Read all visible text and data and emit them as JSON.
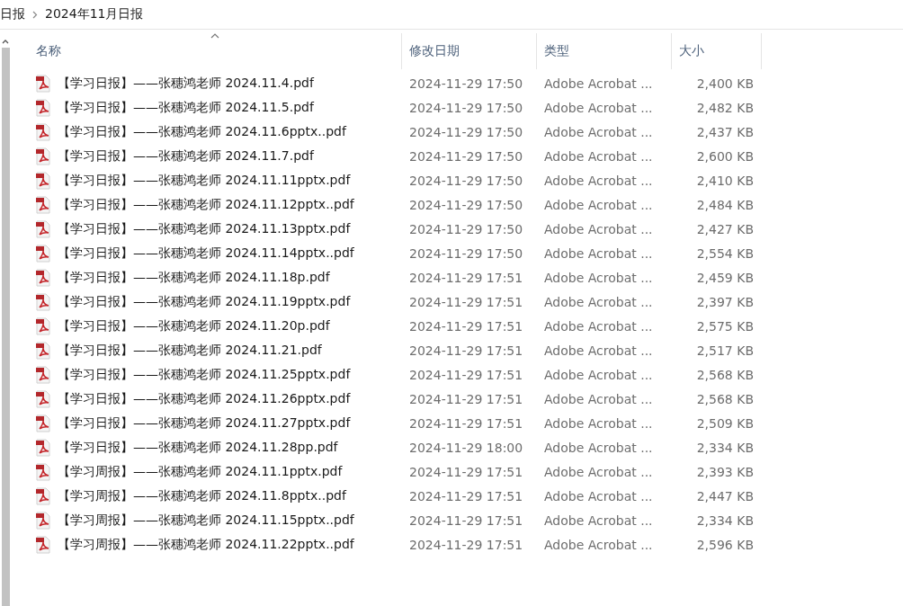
{
  "breadcrumb": [
    "日报",
    "2024年11月日报"
  ],
  "table": {
    "columns": [
      {
        "label": "名称",
        "sorted": true
      },
      {
        "label": "修改日期",
        "sorted": false
      },
      {
        "label": "类型",
        "sorted": false
      },
      {
        "label": "大小",
        "sorted": false
      }
    ],
    "rows": [
      {
        "name": "【学习日报】——张穗鸿老师 2024.11.4.pdf",
        "modified": "2024-11-29 17:50",
        "type": "Adobe Acrobat ...",
        "size": "2,400 KB"
      },
      {
        "name": "【学习日报】——张穗鸿老师 2024.11.5.pdf",
        "modified": "2024-11-29 17:50",
        "type": "Adobe Acrobat ...",
        "size": "2,482 KB"
      },
      {
        "name": "【学习日报】——张穗鸿老师 2024.11.6pptx..pdf",
        "modified": "2024-11-29 17:50",
        "type": "Adobe Acrobat ...",
        "size": "2,437 KB"
      },
      {
        "name": "【学习日报】——张穗鸿老师 2024.11.7.pdf",
        "modified": "2024-11-29 17:50",
        "type": "Adobe Acrobat ...",
        "size": "2,600 KB"
      },
      {
        "name": "【学习日报】——张穗鸿老师 2024.11.11pptx.pdf",
        "modified": "2024-11-29 17:50",
        "type": "Adobe Acrobat ...",
        "size": "2,410 KB"
      },
      {
        "name": "【学习日报】——张穗鸿老师 2024.11.12pptx..pdf",
        "modified": "2024-11-29 17:50",
        "type": "Adobe Acrobat ...",
        "size": "2,484 KB"
      },
      {
        "name": "【学习日报】——张穗鸿老师 2024.11.13pptx.pdf",
        "modified": "2024-11-29 17:50",
        "type": "Adobe Acrobat ...",
        "size": "2,427 KB"
      },
      {
        "name": "【学习日报】——张穗鸿老师 2024.11.14pptx..pdf",
        "modified": "2024-11-29 17:50",
        "type": "Adobe Acrobat ...",
        "size": "2,554 KB"
      },
      {
        "name": "【学习日报】——张穗鸿老师 2024.11.18p.pdf",
        "modified": "2024-11-29 17:51",
        "type": "Adobe Acrobat ...",
        "size": "2,459 KB"
      },
      {
        "name": "【学习日报】——张穗鸿老师 2024.11.19pptx.pdf",
        "modified": "2024-11-29 17:51",
        "type": "Adobe Acrobat ...",
        "size": "2,397 KB"
      },
      {
        "name": "【学习日报】——张穗鸿老师 2024.11.20p.pdf",
        "modified": "2024-11-29 17:51",
        "type": "Adobe Acrobat ...",
        "size": "2,575 KB"
      },
      {
        "name": "【学习日报】——张穗鸿老师 2024.11.21.pdf",
        "modified": "2024-11-29 17:51",
        "type": "Adobe Acrobat ...",
        "size": "2,517 KB"
      },
      {
        "name": "【学习日报】——张穗鸿老师 2024.11.25pptx.pdf",
        "modified": "2024-11-29 17:51",
        "type": "Adobe Acrobat ...",
        "size": "2,568 KB"
      },
      {
        "name": "【学习日报】——张穗鸿老师 2024.11.26pptx.pdf",
        "modified": "2024-11-29 17:51",
        "type": "Adobe Acrobat ...",
        "size": "2,568 KB"
      },
      {
        "name": "【学习日报】——张穗鸿老师 2024.11.27pptx.pdf",
        "modified": "2024-11-29 17:51",
        "type": "Adobe Acrobat ...",
        "size": "2,509 KB"
      },
      {
        "name": "【学习日报】——张穗鸿老师 2024.11.28pp.pdf",
        "modified": "2024-11-29 18:00",
        "type": "Adobe Acrobat ...",
        "size": "2,334 KB"
      },
      {
        "name": "【学习周报】——张穗鸿老师 2024.11.1pptx.pdf",
        "modified": "2024-11-29 17:51",
        "type": "Adobe Acrobat ...",
        "size": "2,393 KB"
      },
      {
        "name": "【学习周报】——张穗鸿老师 2024.11.8pptx..pdf",
        "modified": "2024-11-29 17:51",
        "type": "Adobe Acrobat ...",
        "size": "2,447 KB"
      },
      {
        "name": "【学习周报】——张穗鸿老师 2024.11.15pptx..pdf",
        "modified": "2024-11-29 17:51",
        "type": "Adobe Acrobat ...",
        "size": "2,334 KB"
      },
      {
        "name": "【学习周报】——张穗鸿老师 2024.11.22pptx..pdf",
        "modified": "2024-11-29 17:51",
        "type": "Adobe Acrobat ...",
        "size": "2,596 KB"
      }
    ]
  }
}
